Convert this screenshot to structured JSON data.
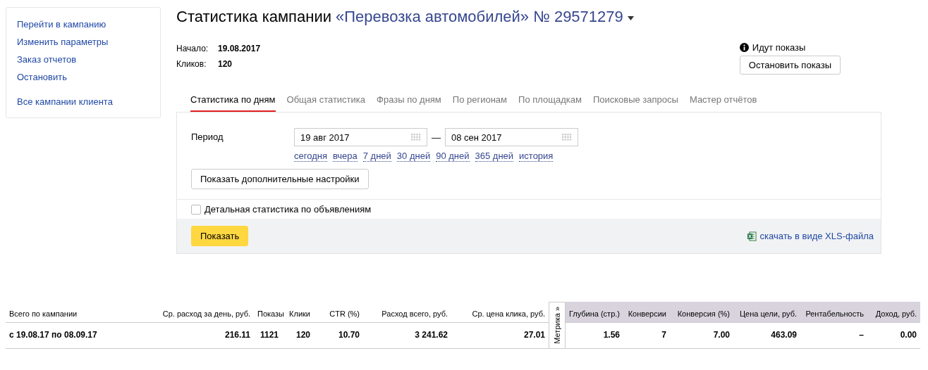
{
  "sidebar": {
    "groups": [
      [
        "Перейти в кампанию",
        "Изменить параметры",
        "Заказ отчетов",
        "Остановить"
      ],
      [
        "Все кампании клиента"
      ]
    ]
  },
  "header": {
    "title": "Статистика кампании",
    "campaign": "«Перевозка автомобилей» № 29571279",
    "has_menu": true
  },
  "summary": [
    {
      "label": "Начало:",
      "value": "19.08.2017"
    },
    {
      "label": "Кликов:",
      "value": "120"
    }
  ],
  "status": {
    "text": "Идут показы",
    "button": "Остановить показы"
  },
  "tabs": [
    {
      "label": "Статистика по дням",
      "selected": true
    },
    {
      "label": "Общая статистика",
      "selected": false
    },
    {
      "label": "Фразы по дням",
      "selected": false
    },
    {
      "label": "По регионам",
      "selected": false
    },
    {
      "label": "По площадкам",
      "selected": false
    },
    {
      "label": "Поисковые запросы",
      "selected": false
    },
    {
      "label": "Мастер отчётов",
      "selected": false
    }
  ],
  "period": {
    "label": "Период",
    "from": "19 авг 2017",
    "separator": "—",
    "to": "08 сен 2017",
    "presets": [
      "сегодня",
      "вчера",
      "7 дней",
      "30 дней",
      "90 дней",
      "365 дней",
      "история"
    ]
  },
  "more_settings_button": "Показать дополнительные настройки",
  "detail_checkbox": {
    "label": "Детальная статистика по объявлениям",
    "checked": false
  },
  "show_button": "Показать",
  "download_link": "скачать в виде XLS-файла",
  "table": {
    "metrika_toggle": "Метрика »",
    "columns": [
      {
        "label": "Всего по кампании",
        "shaded": false
      },
      {
        "label": "Ср. расход за день, руб.",
        "shaded": false
      },
      {
        "label": "Показы",
        "shaded": false
      },
      {
        "label": "Клики",
        "shaded": false
      },
      {
        "label": "CTR (%)",
        "shaded": false
      },
      {
        "label": "Расход всего, руб.",
        "shaded": false
      },
      {
        "label": "Ср. цена клика, руб.",
        "shaded": false
      },
      {
        "label": "Глубина (стр.)",
        "shaded": true
      },
      {
        "label": "Конверсии",
        "shaded": true
      },
      {
        "label": "Конверсия (%)",
        "shaded": true
      },
      {
        "label": "Цена цели, руб.",
        "shaded": true
      },
      {
        "label": "Рентабельность",
        "shaded": true
      },
      {
        "label": "Доход, руб.",
        "shaded": true
      }
    ],
    "rows": [
      [
        "с 19.08.17 по 08.09.17",
        "216.11",
        "1121",
        "120",
        "10.70",
        "3 241.62",
        "27.01",
        "1.56",
        "7",
        "7.00",
        "463.09",
        "–",
        "0.00"
      ]
    ]
  }
}
